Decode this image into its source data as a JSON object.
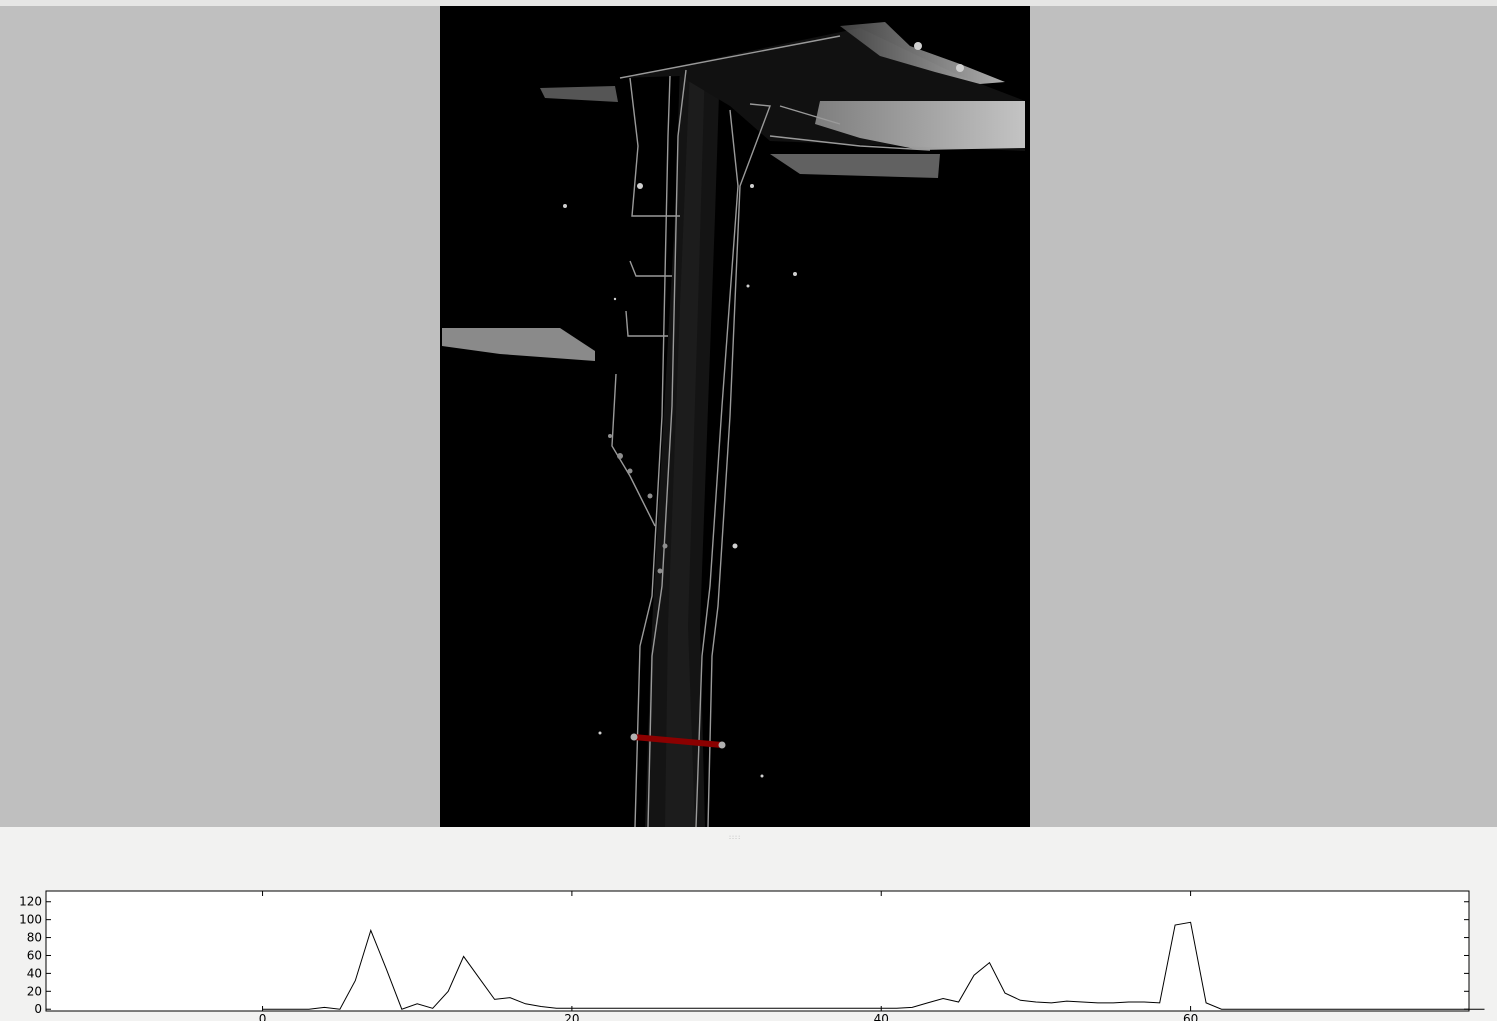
{
  "viewer": {
    "background_color": "#bfbfbf",
    "image_background": "#000000",
    "profile_line_color": "#8b0000",
    "profile_handle_color": "#b0b0b0"
  },
  "splitter": {
    "grip": "::::"
  },
  "chart_data": {
    "type": "line",
    "title": "",
    "xlabel": "",
    "ylabel": "",
    "xlim": [
      -14,
      78
    ],
    "ylim": [
      -2,
      132
    ],
    "x_ticks": [
      0,
      20,
      40,
      60
    ],
    "y_ticks": [
      0,
      20,
      40,
      60,
      80,
      100,
      120
    ],
    "x_tick_labels": [
      "0",
      "20",
      "40",
      "60"
    ],
    "y_tick_labels": [
      "0",
      "20",
      "40",
      "60",
      "80",
      "100",
      "120"
    ],
    "grid": false,
    "legend": "none",
    "line_color": "#000000",
    "series": [
      {
        "x": [
          0,
          1,
          2,
          3,
          4,
          5,
          6,
          7,
          8,
          9,
          10,
          11,
          12,
          13,
          14,
          15,
          16,
          17,
          18,
          19,
          20,
          21,
          22,
          23,
          24,
          25,
          26,
          27,
          28,
          29,
          30,
          31,
          32,
          33,
          34,
          35,
          36,
          37,
          38,
          39,
          40,
          41,
          42,
          43,
          44,
          45,
          46,
          47,
          48,
          49,
          50,
          51,
          52,
          53,
          54,
          55,
          56,
          57,
          58,
          59,
          60,
          61,
          62,
          63,
          64,
          65,
          66,
          67,
          68,
          69,
          70,
          71,
          72,
          73,
          74,
          75,
          76,
          77,
          78,
          79
        ],
        "y": [
          0,
          0,
          0,
          0,
          2,
          0,
          32,
          88,
          45,
          0,
          6,
          1,
          20,
          59,
          35,
          11,
          13,
          6,
          3,
          1,
          1,
          1,
          1,
          1,
          1,
          1,
          1,
          1,
          1,
          1,
          1,
          1,
          1,
          1,
          1,
          1,
          1,
          1,
          1,
          1,
          1,
          1,
          2,
          7,
          12,
          8,
          38,
          52,
          18,
          10,
          8,
          7,
          9,
          8,
          7,
          7,
          8,
          8,
          7,
          94,
          97,
          7,
          0,
          0,
          0,
          0,
          0,
          0,
          0,
          0,
          0,
          0,
          0,
          0,
          0,
          0,
          0,
          0,
          0,
          0
        ]
      }
    ]
  }
}
